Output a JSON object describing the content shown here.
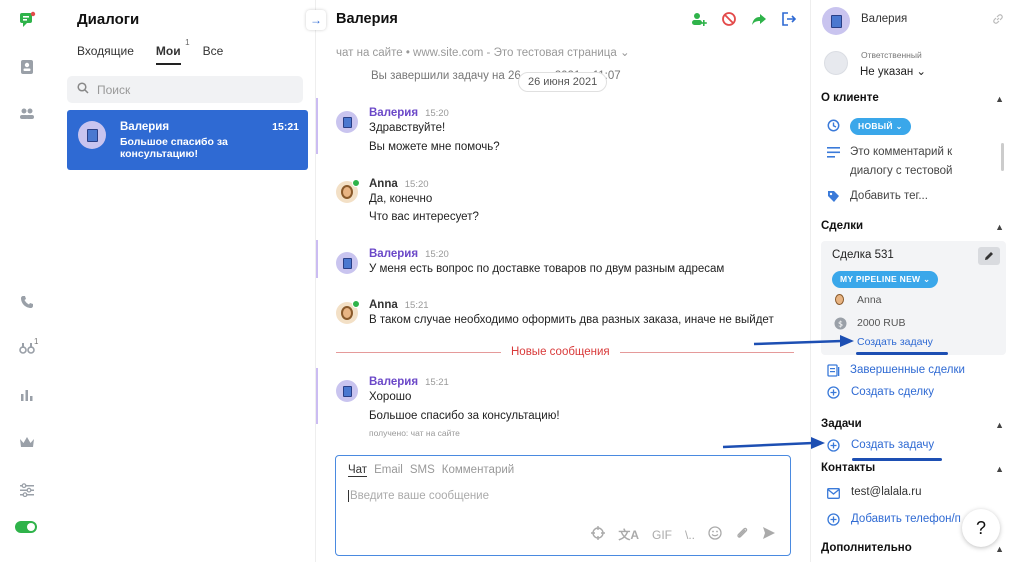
{
  "dialogs": {
    "title": "Диалоги",
    "tabs": [
      {
        "label": "Входящие"
      },
      {
        "label": "Мои",
        "badge": "1"
      },
      {
        "label": "Все"
      }
    ],
    "search_placeholder": "Поиск",
    "items": [
      {
        "name": "Валерия",
        "time": "15:21",
        "preview": "Большое спасибо за консультацию!"
      }
    ]
  },
  "rail": {
    "notifications_badge": "1"
  },
  "chat": {
    "title": "Валерия",
    "source": "чат на сайте • www.site.com - Это тестовая страница ⌄",
    "system_message": "Вы завершили задачу на 26 июня 2021 г. 11:07",
    "date_pill": "26 июня 2021",
    "messages": [
      {
        "author": "Валерия",
        "time": "15:20",
        "lines": [
          "Здравствуйте!",
          "Вы можете мне помочь?"
        ]
      },
      {
        "author": "Anna",
        "time": "15:20",
        "lines": [
          "Да, конечно",
          "Что вас интересует?"
        ]
      },
      {
        "author": "Валерия",
        "time": "15:20",
        "lines": [
          "У меня есть вопрос по доставке товаров по двум разным адресам"
        ]
      },
      {
        "author": "Anna",
        "time": "15:21",
        "lines": [
          "В таком случае необходимо оформить два разных заказа, иначе не выйдет"
        ]
      },
      {
        "author": "Валерия",
        "time": "15:21",
        "lines": [
          "Хорошо",
          "Большое спасибо за консультацию!"
        ]
      }
    ],
    "new_messages_label": "Новые сообщения",
    "received_via": "получено: чат на сайте",
    "composer": {
      "tabs": [
        "Чат",
        "Email",
        "SMS",
        "Комментарий"
      ],
      "placeholder": "Введите ваше сообщение",
      "gif_label": "GIF",
      "template_label": "\\.."
    }
  },
  "right": {
    "client_name": "Валерия",
    "responsible_label": "Ответственный",
    "responsible_value": "Не указан ⌄",
    "about_title": "О клиенте",
    "status_pill": "НОВЫЙ ⌄",
    "comment_line1": "Это комментарий к",
    "comment_line2": "диалогу с тестовой",
    "add_tag": "Добавить тег...",
    "deals_title": "Сделки",
    "deal_name": "Сделка 531",
    "pipeline_pill": "MY PIPELINE   NEW ⌄",
    "deal_owner": "Anna",
    "deal_amount": "2000 RUB",
    "deal_create_task": "Создать задачу",
    "completed_deals": "Завершенные сделки",
    "create_deal": "Создать сделку",
    "tasks_title": "Задачи",
    "create_task": "Создать задачу",
    "contacts_title": "Контакты",
    "email": "test@lalala.ru",
    "add_phone": "Добавить телефон/п",
    "extra_title": "Дополнительно"
  },
  "help_label": "?",
  "colors": {
    "accent": "#2f6ad3",
    "client_name": "#6b48c8",
    "new_messages": "#d93a3a",
    "online": "#2fb34a",
    "pill": "#3aa7ea",
    "arrow": "#1d4fb3"
  }
}
